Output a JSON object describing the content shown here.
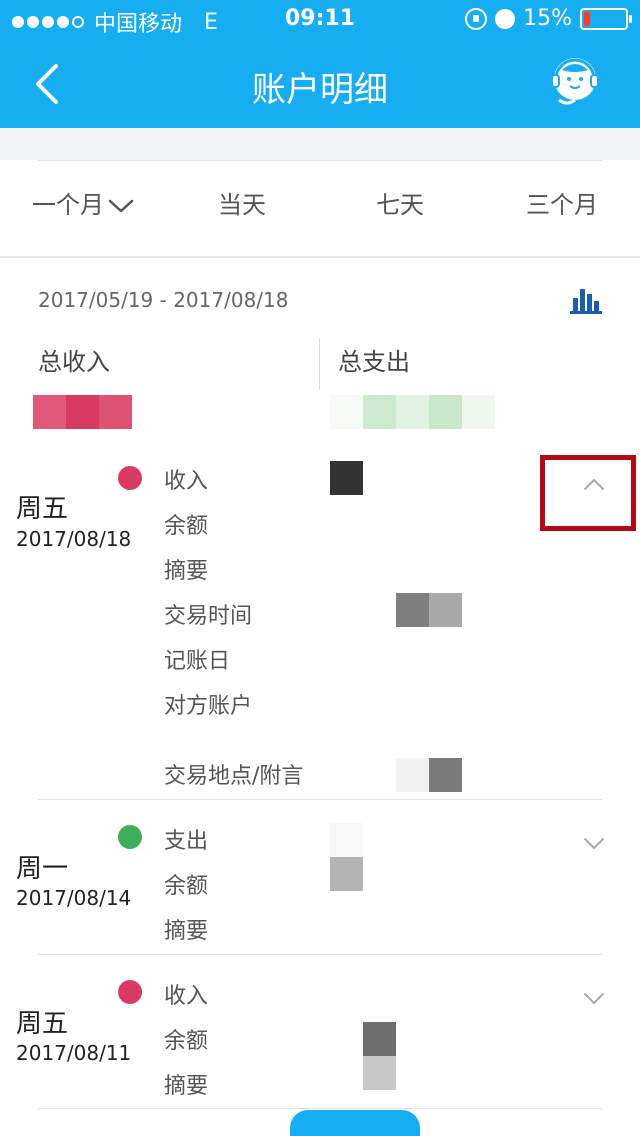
{
  "status_bar": {
    "carrier": "中国移动",
    "network": "E",
    "time": "09:11",
    "battery": "15%",
    "battery_level": 0.15
  },
  "nav": {
    "title": "账户明细",
    "back_icon": "chevron-left-icon",
    "service_icon": "customer-service-icon"
  },
  "filters": {
    "items": [
      "一个月",
      "当天",
      "七天",
      "三个月"
    ],
    "selected": 0
  },
  "summary": {
    "date_range": "2017/05/19 - 2017/08/18",
    "income_label": "总收入",
    "expense_label": "总支出",
    "chart_icon": "bar-chart-icon"
  },
  "records": [
    {
      "weekday": "周五",
      "date": "2017/08/18",
      "type_color": "#d93a63",
      "expanded": true,
      "labels": [
        "收入",
        "余额",
        "摘要",
        "交易时间",
        "记账日",
        "对方账户",
        "交易地点/附言"
      ]
    },
    {
      "weekday": "周一",
      "date": "2017/08/14",
      "type_color": "#3fae58",
      "expanded": false,
      "labels": [
        "支出",
        "余额",
        "摘要"
      ]
    },
    {
      "weekday": "周五",
      "date": "2017/08/11",
      "type_color": "#d93a63",
      "expanded": false,
      "labels": [
        "收入",
        "余额",
        "摘要"
      ]
    }
  ],
  "colors": {
    "brand": "#16aef0",
    "highlight": "#b00b14"
  }
}
